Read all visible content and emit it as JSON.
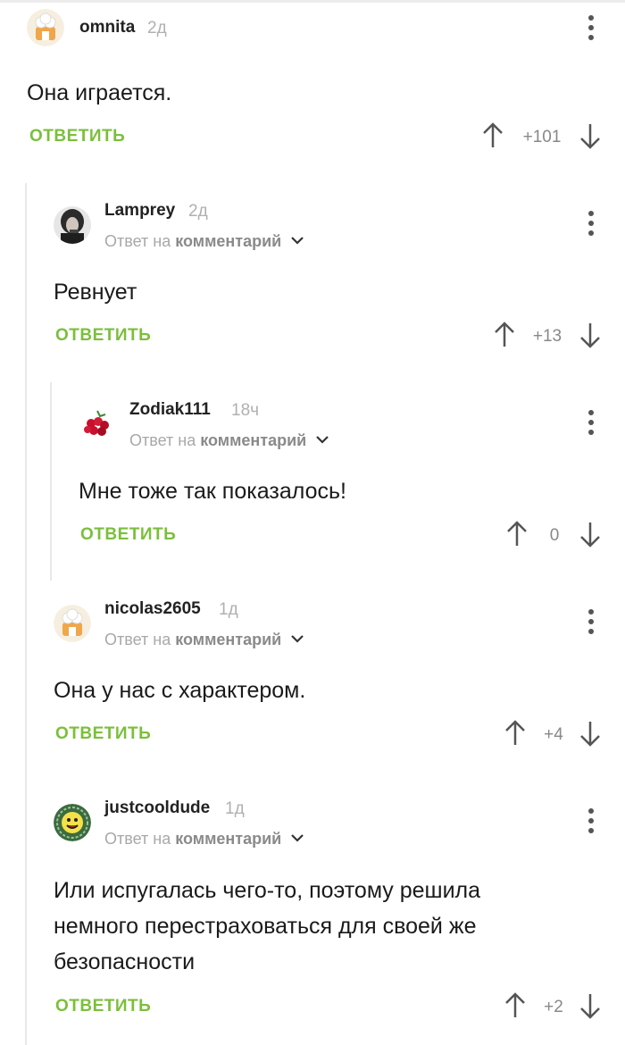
{
  "comments": [
    {
      "username": "omnita",
      "time": "2д",
      "avatar": "chef-hat-avatar",
      "text": "Она играется.",
      "reply_label": "ОТВЕТИТЬ",
      "score": "+101"
    },
    {
      "username": "Lamprey",
      "time": "2д",
      "avatar": "photo-avatar",
      "reply_prefix": "Ответ на",
      "reply_target": "комментарий",
      "text": "Ревнует",
      "reply_label": "ОТВЕТИТЬ",
      "score": "+13"
    },
    {
      "username": "Zodiak111",
      "time": "18ч",
      "avatar": "berries-avatar",
      "reply_prefix": "Ответ на",
      "reply_target": "комментарий",
      "text": "Мне тоже так показалось!",
      "reply_label": "ОТВЕТИТЬ",
      "score": "0"
    },
    {
      "username": "nicolas2605",
      "time": "1д",
      "avatar": "chef-hat-avatar",
      "reply_prefix": "Ответ на",
      "reply_target": "комментарий",
      "text": "Она у нас с характером.",
      "reply_label": "ОТВЕТИТЬ",
      "score": "+4"
    },
    {
      "username": "justcooldude",
      "time": "1д",
      "avatar": "smiley-avatar",
      "reply_prefix": "Ответ на",
      "reply_target": "комментарий",
      "text": "Или испугалась чего-то, поэтому решила\nнемного перестраховаться для своей же\nбезопасности",
      "reply_label": "ОТВЕТИТЬ",
      "score": "+2"
    }
  ],
  "colors": {
    "accent": "#7bbf3b",
    "thread_line": "#e8e8e8",
    "muted": "#a8a8a8"
  }
}
